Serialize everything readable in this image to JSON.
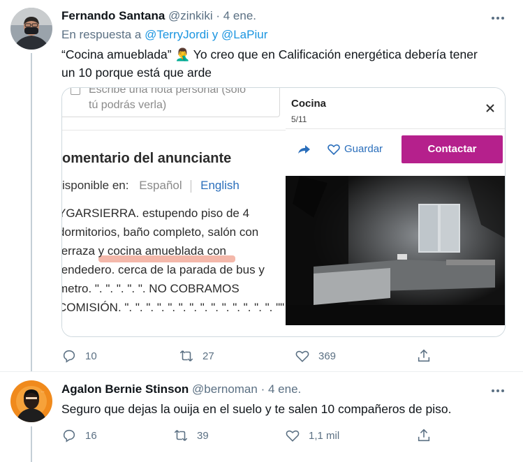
{
  "tweets": [
    {
      "author_name": "Fernando Santana",
      "author_handle": "@zinkiki",
      "separator": "·",
      "date": "4 ene.",
      "reply_prefix": "En respuesta a",
      "reply_mentions": [
        "@TerryJordi",
        "y",
        "@LaPiur"
      ],
      "text_line1": "“Cocina amueblada” 🤦‍♂️  Yo creo que en Calificación energética debería tener",
      "text_line2": "un 10 porque está que arde",
      "stats": {
        "replies": "10",
        "retweets": "27",
        "likes": "369"
      },
      "media": {
        "left": {
          "note_line1": "Escribe una nota personal (solo",
          "note_line2": "tú podrás verla)",
          "heading": "omentario del anunciante",
          "lang_label": "isponible en:",
          "lang_spanish": "Español",
          "lang_english": "English",
          "body_lines": [
            "YGARSIERRA. estupendo piso de 4",
            "dormitorios, baño completo, salón con",
            "terraza y cocina amueblada con",
            "tendedero. cerca de la parada de bus y",
            "metro. \". \". \". \". \". NO COBRAMOS",
            "COMISIÓN. \". \". \". \". \". \". \". \". \". \". \". \". \". \". \"\""
          ]
        },
        "right": {
          "title": "Cocina",
          "counter": "5/11",
          "save_label": "Guardar",
          "contact_label": "Contactar",
          "accent": "#b5208c"
        }
      }
    },
    {
      "author_name": "Agalon Bernie Stinson",
      "author_handle": "@bernoman",
      "separator": "·",
      "date": "4 ene.",
      "text_line1": "Seguro que dejas la ouija en el suelo y te salen 10 compañeros de piso.",
      "stats": {
        "replies": "16",
        "retweets": "39",
        "likes": "1,1 mil"
      }
    }
  ],
  "icons": [
    "more-icon",
    "reply-icon",
    "retweet-icon",
    "like-icon",
    "share-icon",
    "close-icon",
    "arrow-share-icon",
    "heart-outline-icon"
  ],
  "colors": {
    "link": "#1b95e0",
    "muted": "#5b7083",
    "thread": "#c4cfd6"
  }
}
